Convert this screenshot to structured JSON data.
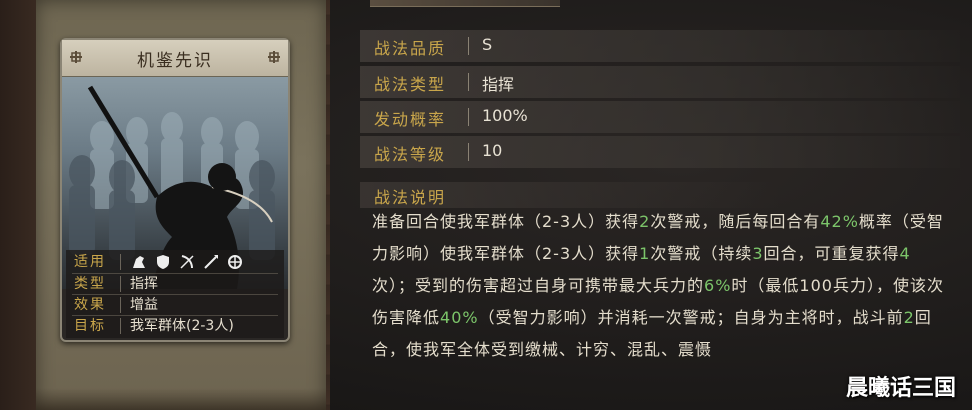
{
  "card": {
    "title": "机鉴先识",
    "rows": [
      {
        "key": "适用",
        "icons": [
          "cavalry-icon",
          "shield-icon",
          "archer-icon",
          "spear-icon",
          "siege-icon"
        ]
      },
      {
        "key": "类型",
        "value": "指挥"
      },
      {
        "key": "效果",
        "value": "增益"
      },
      {
        "key": "目标",
        "value": "我军群体(2-3人)"
      }
    ]
  },
  "stats": [
    {
      "label": "战法品质",
      "value": "S"
    },
    {
      "label": "战法类型",
      "value": "指挥"
    },
    {
      "label": "发动概率",
      "value": "100%"
    },
    {
      "label": "战法等级",
      "value": "10"
    }
  ],
  "description": {
    "title": "战法说明",
    "segments": [
      {
        "t": "准备回合使我军群体（2-3人）获得"
      },
      {
        "t": "2",
        "hl": true
      },
      {
        "t": "次警戒，随后每回合有"
      },
      {
        "t": "42%",
        "hl": true
      },
      {
        "t": "概率（受智力影响）使我军群体（2-3人）获得"
      },
      {
        "t": "1",
        "hl": true
      },
      {
        "t": "次警戒（持续"
      },
      {
        "t": "3",
        "hl": true
      },
      {
        "t": "回合，可重复获得"
      },
      {
        "t": "4",
        "hl": true
      },
      {
        "t": "次）；受到的伤害超过自身可携带最大兵力的"
      },
      {
        "t": "6%",
        "hl": true
      },
      {
        "t": "时（最低100兵力），使该次伤害降低"
      },
      {
        "t": "40%",
        "hl": true
      },
      {
        "t": "（受智力影响）并消耗一次警戒；自身为主将时，战斗前"
      },
      {
        "t": "2",
        "hl": true
      },
      {
        "t": "回合，使我军全体受到缴械、计穷、混乱、震慑"
      }
    ]
  },
  "watermark": "晨曦话三国",
  "colors": {
    "accent": "#c9a64b",
    "highlight": "#7cc56a"
  }
}
